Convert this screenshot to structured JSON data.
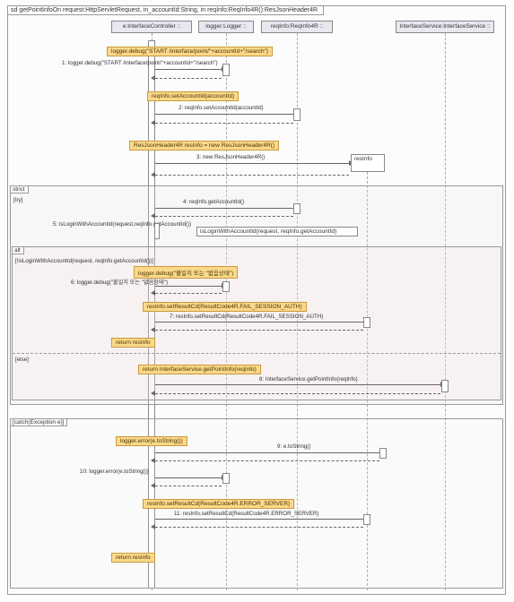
{
  "frame_title": "sd getPointInfoOn request:HttpServletRequest, in_accountId:String, in reqInfo:ReqInfo4R():ResJsonHeader4R",
  "participants": {
    "controller": "e:InterfaceController ::",
    "logger": "logger:Logger ::",
    "reqinfo": "reqInfo:ReqInfo4R ::",
    "service": "InterfaceService:InterfaceService ::"
  },
  "note_resinfo": "resInfo",
  "messages": {
    "m1_box": "logger.debug(\"START /interface/point/\"+accountId+\"/search\")",
    "m1_text": "1: logger.debug(\"START /interface/point/\"+accountId+\"/search\")",
    "m2_box": "reqInfo.setAccountId(accountId)",
    "m2_text": "2: reqInfo.setAccountId(accountId)",
    "m3_box": "ResJsonHeader4R resInfo = new ResJsonHeader4R()",
    "m3_text": "3: new ResJsonHeader4R()",
    "m4_text": "4: reqInfo.getAccountId()",
    "m5_text": "5: isLoginWithAccountId(request,reqInfo.getAccountId())",
    "m5_self": "isLoginWithAccountId(request, reqInfo.getAccountId)",
    "m6_box": "logger.debug(\"불일치 또는 \"없음상태\")",
    "m6_text": "6: logger.debug(\"불일치 또는 \"없음상태\")",
    "m7_box": "resInfo.setResultCd(ResultCode4R.FAIL_SESSION_AUTH)",
    "m7_text": "7: resInfo.setResultCd(ResultCode4R.FAIL_SESSION_AUTH)",
    "m8_box": "return resInfo",
    "m9_box": "return InterfaceService.getPointInfo(reqInfo)",
    "m9_text": "8: InterfaceService.getPointInfo(reqInfo)",
    "m10_box": "logger.error(e.toString())",
    "m10_text": "10: logger.error(e.toString())",
    "m10r_text": "9: e.toString()",
    "m11_box": "resInfo.setResultCd(ResultCode4R.ERROR_SERVER)",
    "m11_text": "11: resInfo.setResultCd(ResultCode4R.ERROR_SERVER)",
    "m12_box": "return resInfo"
  },
  "fragments": {
    "strict": "strict",
    "try": "[try]",
    "alt": "alt",
    "alt_guard": "[!isLoginWithAccountId(request, reqInfo.getAccountId())]",
    "else": "[else]",
    "catch": "[catch(Exception e)]"
  },
  "chart_data": {
    "type": "sequence-diagram",
    "participants": [
      "e:InterfaceController",
      "logger:Logger",
      "reqInfo:ReqInfo4R",
      "resInfo:ResJsonHeader4R",
      "InterfaceService:InterfaceService"
    ],
    "fragments": [
      {
        "type": "strict",
        "guard": "try",
        "children": [
          {
            "type": "alt",
            "guard": "!isLoginWithAccountId(request, reqInfo.getAccountId())",
            "else": true
          }
        ]
      },
      {
        "type": "catch",
        "guard": "Exception e"
      }
    ],
    "messages": [
      {
        "n": 1,
        "from": "controller",
        "to": "logger",
        "label": "logger.debug(\"START /interface/point/\"+accountId+\"/search\")"
      },
      {
        "n": 2,
        "from": "controller",
        "to": "reqInfo",
        "label": "reqInfo.setAccountId(accountId)"
      },
      {
        "n": 3,
        "from": "controller",
        "to": "resInfo",
        "label": "new ResJsonHeader4R()",
        "create": true
      },
      {
        "n": 4,
        "from": "controller",
        "to": "reqInfo",
        "label": "reqInfo.getAccountId()"
      },
      {
        "n": 5,
        "from": "controller",
        "to": "controller",
        "label": "isLoginWithAccountId(request,reqInfo.getAccountId())",
        "self": true
      },
      {
        "n": 6,
        "from": "controller",
        "to": "logger",
        "label": "logger.debug(\"불일치 또는 없음상태\")"
      },
      {
        "n": 7,
        "from": "controller",
        "to": "resInfo",
        "label": "resInfo.setResultCd(ResultCode4R.FAIL_SESSION_AUTH)"
      },
      {
        "n": null,
        "from": "controller",
        "to": "caller",
        "label": "return resInfo",
        "return": true
      },
      {
        "n": 8,
        "from": "controller",
        "to": "InterfaceService",
        "label": "InterfaceService.getPointInfo(reqInfo)"
      },
      {
        "n": null,
        "from": "controller",
        "to": "caller",
        "label": "return InterfaceService.getPointInfo(reqInfo)",
        "return": true
      },
      {
        "n": 9,
        "from": "controller",
        "to": "e",
        "label": "e.toString()"
      },
      {
        "n": 10,
        "from": "controller",
        "to": "logger",
        "label": "logger.error(e.toString())"
      },
      {
        "n": 11,
        "from": "controller",
        "to": "resInfo",
        "label": "resInfo.setResultCd(ResultCode4R.ERROR_SERVER)"
      },
      {
        "n": null,
        "from": "controller",
        "to": "caller",
        "label": "return resInfo",
        "return": true
      }
    ]
  }
}
